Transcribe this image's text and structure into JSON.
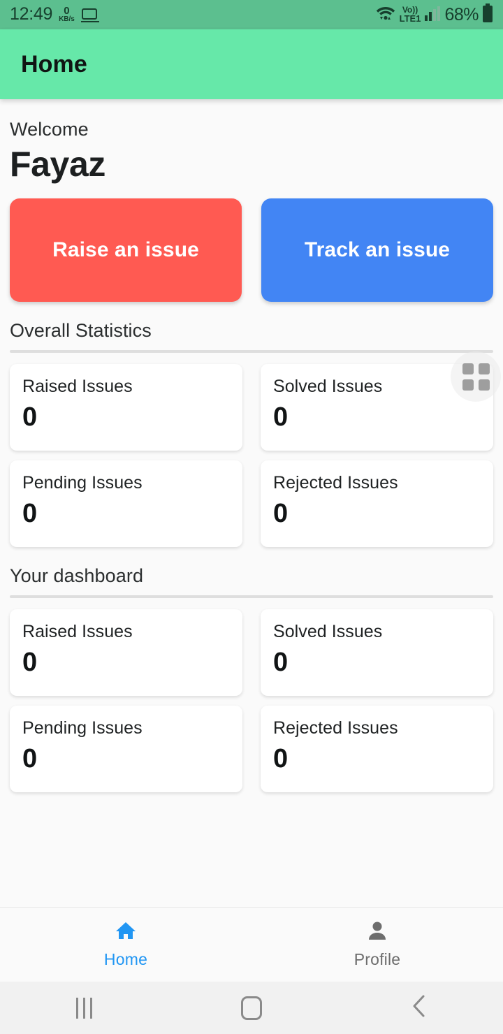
{
  "status_bar": {
    "time": "12:49",
    "network_speed_value": "0",
    "network_speed_unit": "KB/s",
    "cast_icon": "monitor-icon",
    "wifi_icon": "wifi-icon",
    "volte_label_top": "Vo))",
    "volte_label_bottom": "LTE1",
    "signal_icon": "signal-bars-icon",
    "battery_percent": "68%",
    "battery_icon": "battery-icon"
  },
  "app_bar": {
    "title": "Home",
    "background_color": "#66e8a9"
  },
  "welcome": {
    "greeting": "Welcome",
    "name": "Fayaz"
  },
  "actions": {
    "raise_label": "Raise an issue",
    "raise_color": "#ff5a52",
    "track_label": "Track an issue",
    "track_color": "#4285f4"
  },
  "overall_statistics": {
    "title": "Overall Statistics",
    "cards": [
      {
        "label": "Raised Issues",
        "value": "0"
      },
      {
        "label": "Solved Issues",
        "value": "0"
      },
      {
        "label": "Pending Issues",
        "value": "0"
      },
      {
        "label": "Rejected Issues",
        "value": "0"
      }
    ]
  },
  "your_dashboard": {
    "title": "Your dashboard",
    "cards": [
      {
        "label": "Raised Issues",
        "value": "0"
      },
      {
        "label": "Solved Issues",
        "value": "0"
      },
      {
        "label": "Pending Issues",
        "value": "0"
      },
      {
        "label": "Rejected Issues",
        "value": "0"
      }
    ]
  },
  "floating_overlay": {
    "icon": "grid-squares-icon"
  },
  "bottom_nav": {
    "items": [
      {
        "label": "Home",
        "icon": "home-icon",
        "active": true,
        "color": "#2196f3"
      },
      {
        "label": "Profile",
        "icon": "person-icon",
        "active": false,
        "color": "#6d6d6d"
      }
    ]
  },
  "system_nav": {
    "recents_icon": "recents-icon",
    "home_icon": "home-square-icon",
    "back_icon": "back-chevron-icon"
  }
}
